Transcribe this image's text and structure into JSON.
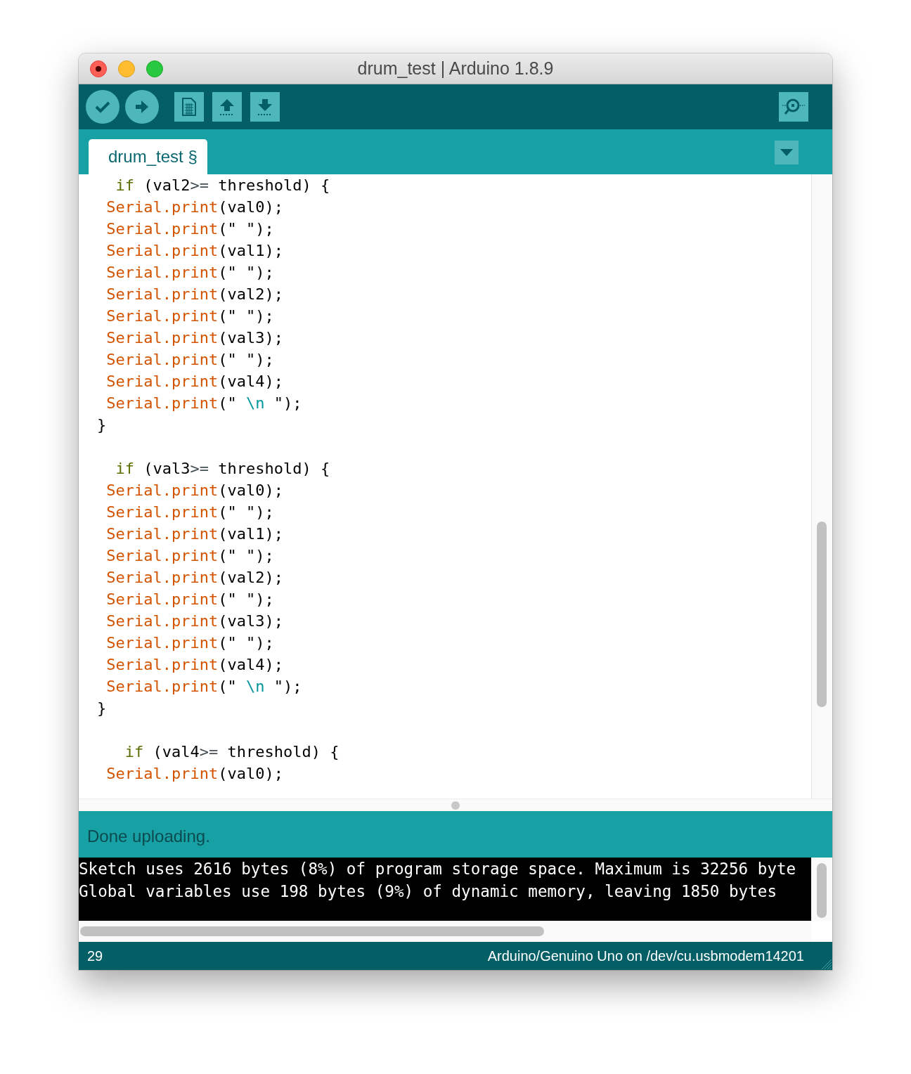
{
  "window": {
    "title": "drum_test | Arduino 1.8.9"
  },
  "tabs": [
    {
      "label": "drum_test §",
      "selected": true
    }
  ],
  "code_lines": [
    {
      "kind": "code",
      "segments": [
        {
          "kind": "keyword",
          "text": "  if"
        },
        {
          "kind": "plain",
          "text": " (val2"
        },
        {
          "kind": "operator",
          "text": ">="
        },
        {
          "kind": "plain",
          "text": " threshold) {"
        }
      ]
    },
    {
      "kind": "code",
      "segments": [
        {
          "kind": "function",
          "text": " Serial.print"
        },
        {
          "kind": "plain",
          "text": "(val0);"
        }
      ]
    },
    {
      "kind": "code",
      "segments": [
        {
          "kind": "function",
          "text": " Serial.print"
        },
        {
          "kind": "plain",
          "text": "(\" \");"
        }
      ]
    },
    {
      "kind": "code",
      "segments": [
        {
          "kind": "function",
          "text": " Serial.print"
        },
        {
          "kind": "plain",
          "text": "(val1);"
        }
      ]
    },
    {
      "kind": "code",
      "segments": [
        {
          "kind": "function",
          "text": " Serial.print"
        },
        {
          "kind": "plain",
          "text": "(\" \");"
        }
      ]
    },
    {
      "kind": "code",
      "segments": [
        {
          "kind": "function",
          "text": " Serial.print"
        },
        {
          "kind": "plain",
          "text": "(val2);"
        }
      ]
    },
    {
      "kind": "code",
      "segments": [
        {
          "kind": "function",
          "text": " Serial.print"
        },
        {
          "kind": "plain",
          "text": "(\" \");"
        }
      ]
    },
    {
      "kind": "code",
      "segments": [
        {
          "kind": "function",
          "text": " Serial.print"
        },
        {
          "kind": "plain",
          "text": "(val3);"
        }
      ]
    },
    {
      "kind": "code",
      "segments": [
        {
          "kind": "function",
          "text": " Serial.print"
        },
        {
          "kind": "plain",
          "text": "(\" \");"
        }
      ]
    },
    {
      "kind": "code",
      "segments": [
        {
          "kind": "function",
          "text": " Serial.print"
        },
        {
          "kind": "plain",
          "text": "(val4);"
        }
      ]
    },
    {
      "kind": "code",
      "segments": [
        {
          "kind": "function",
          "text": " Serial.print"
        },
        {
          "kind": "plain",
          "text": "(\" "
        },
        {
          "kind": "escape",
          "text": "\\n"
        },
        {
          "kind": "plain",
          "text": " \");"
        }
      ]
    },
    {
      "kind": "code",
      "segments": [
        {
          "kind": "plain",
          "text": "}"
        }
      ]
    },
    {
      "kind": "blank"
    },
    {
      "kind": "code",
      "segments": [
        {
          "kind": "keyword",
          "text": "  if"
        },
        {
          "kind": "plain",
          "text": " (val3"
        },
        {
          "kind": "operator",
          "text": ">="
        },
        {
          "kind": "plain",
          "text": " threshold) {"
        }
      ]
    },
    {
      "kind": "code",
      "segments": [
        {
          "kind": "function",
          "text": " Serial.print"
        },
        {
          "kind": "plain",
          "text": "(val0);"
        }
      ]
    },
    {
      "kind": "code",
      "segments": [
        {
          "kind": "function",
          "text": " Serial.print"
        },
        {
          "kind": "plain",
          "text": "(\" \");"
        }
      ]
    },
    {
      "kind": "code",
      "segments": [
        {
          "kind": "function",
          "text": " Serial.print"
        },
        {
          "kind": "plain",
          "text": "(val1);"
        }
      ]
    },
    {
      "kind": "code",
      "segments": [
        {
          "kind": "function",
          "text": " Serial.print"
        },
        {
          "kind": "plain",
          "text": "(\" \");"
        }
      ]
    },
    {
      "kind": "code",
      "segments": [
        {
          "kind": "function",
          "text": " Serial.print"
        },
        {
          "kind": "plain",
          "text": "(val2);"
        }
      ]
    },
    {
      "kind": "code",
      "segments": [
        {
          "kind": "function",
          "text": " Serial.print"
        },
        {
          "kind": "plain",
          "text": "(\" \");"
        }
      ]
    },
    {
      "kind": "code",
      "segments": [
        {
          "kind": "function",
          "text": " Serial.print"
        },
        {
          "kind": "plain",
          "text": "(val3);"
        }
      ]
    },
    {
      "kind": "code",
      "segments": [
        {
          "kind": "function",
          "text": " Serial.print"
        },
        {
          "kind": "plain",
          "text": "(\" \");"
        }
      ]
    },
    {
      "kind": "code",
      "segments": [
        {
          "kind": "function",
          "text": " Serial.print"
        },
        {
          "kind": "plain",
          "text": "(val4);"
        }
      ]
    },
    {
      "kind": "code",
      "segments": [
        {
          "kind": "function",
          "text": " Serial.print"
        },
        {
          "kind": "plain",
          "text": "(\" "
        },
        {
          "kind": "escape",
          "text": "\\n"
        },
        {
          "kind": "plain",
          "text": " \");"
        }
      ]
    },
    {
      "kind": "code",
      "segments": [
        {
          "kind": "plain",
          "text": "}"
        }
      ]
    },
    {
      "kind": "blank"
    },
    {
      "kind": "code",
      "segments": [
        {
          "kind": "keyword",
          "text": "   if"
        },
        {
          "kind": "plain",
          "text": " (val4"
        },
        {
          "kind": "operator",
          "text": ">="
        },
        {
          "kind": "plain",
          "text": " threshold) {"
        }
      ]
    },
    {
      "kind": "code",
      "segments": [
        {
          "kind": "function",
          "text": " Serial.print"
        },
        {
          "kind": "plain",
          "text": "(val0);"
        }
      ]
    }
  ],
  "message": "Done uploading.",
  "console_lines": [
    "Sketch uses 2616 bytes (8%) of program storage space. Maximum is 32256 byte",
    "Global variables use 198 bytes (9%) of dynamic memory, leaving 1850 bytes"
  ],
  "status_bar": {
    "line": "29",
    "board": "Arduino/Genuino Uno on /dev/cu.usbmodem14201"
  }
}
